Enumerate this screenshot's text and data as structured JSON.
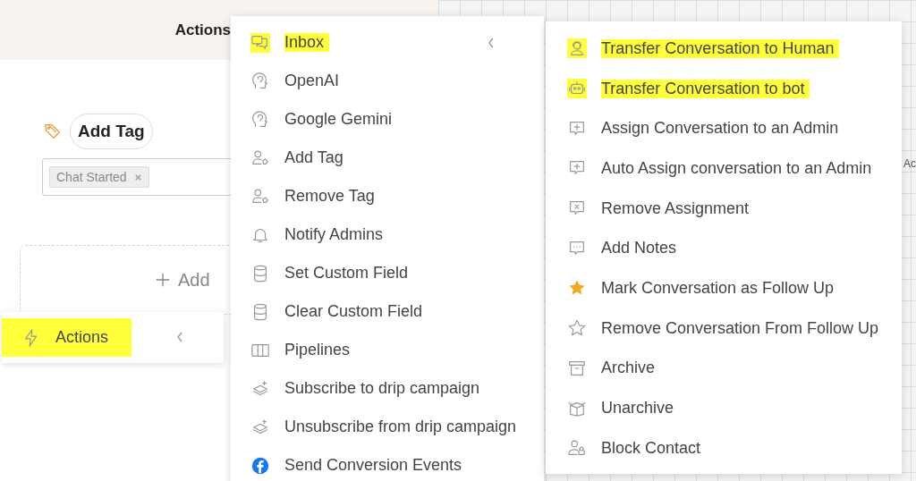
{
  "editor": {
    "header_title": "Actions",
    "node": {
      "title": "Add Tag",
      "tags": [
        "Chat Started"
      ]
    },
    "add_card": {
      "label": "Add"
    },
    "canvas_label": "Ac"
  },
  "actions_menu": {
    "label": "Actions",
    "highlighted": true
  },
  "menu": {
    "items": [
      {
        "label": "Inbox",
        "highlighted": true,
        "expanded": true
      },
      {
        "label": "OpenAI",
        "highlighted": false,
        "expanded": false
      },
      {
        "label": "Google Gemini",
        "highlighted": false,
        "expanded": false
      },
      {
        "label": "Add Tag",
        "highlighted": false,
        "expanded": false
      },
      {
        "label": "Remove Tag",
        "highlighted": false,
        "expanded": false
      },
      {
        "label": "Notify Admins",
        "highlighted": false,
        "expanded": false
      },
      {
        "label": "Set Custom Field",
        "highlighted": false,
        "expanded": false
      },
      {
        "label": "Clear Custom Field",
        "highlighted": false,
        "expanded": false
      },
      {
        "label": "Pipelines",
        "highlighted": false,
        "expanded": false
      },
      {
        "label": "Subscribe to drip campaign",
        "highlighted": false,
        "expanded": false
      },
      {
        "label": "Unsubscribe from drip campaign",
        "highlighted": false,
        "expanded": false
      },
      {
        "label": "Send Conversion Events",
        "highlighted": false,
        "expanded": false
      }
    ]
  },
  "submenu": {
    "items": [
      {
        "label": "Transfer Conversation to Human",
        "highlighted": true
      },
      {
        "label": "Transfer Conversation to bot",
        "highlighted": true
      },
      {
        "label": "Assign Conversation to an Admin",
        "highlighted": false
      },
      {
        "label": "Auto Assign conversation to an Admin",
        "highlighted": false
      },
      {
        "label": "Remove Assignment",
        "highlighted": false
      },
      {
        "label": "Add Notes",
        "highlighted": false
      },
      {
        "label": "Mark Conversation as Follow Up",
        "highlighted": false
      },
      {
        "label": "Remove Conversation From Follow Up",
        "highlighted": false
      },
      {
        "label": "Archive",
        "highlighted": false
      },
      {
        "label": "Unarchive",
        "highlighted": false
      },
      {
        "label": "Block Contact",
        "highlighted": false
      }
    ]
  }
}
